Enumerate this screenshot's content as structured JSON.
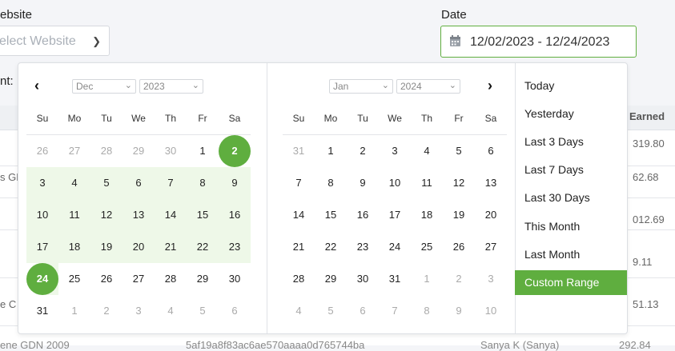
{
  "labels": {
    "website": "ebsite",
    "date": "Date",
    "count": "nt:"
  },
  "website_select": {
    "placeholder": "elect Website"
  },
  "date_input": {
    "value": "12/02/2023 - 12/24/2023"
  },
  "table": {
    "earned_header": "Earned",
    "values": [
      "319.80",
      "62.68",
      "012.69",
      "9.11",
      "51.13",
      "292.84"
    ],
    "left_fragments": [
      "s GD",
      "e C"
    ],
    "bottom_fragments": [
      "ene GDN 2009",
      "5af19a8f83ac6ae570aaaa0d765744ba",
      "Sanya K (Sanya)"
    ]
  },
  "left_calendar": {
    "month": "Dec",
    "year": "2023",
    "dow": [
      "Su",
      "Mo",
      "Tu",
      "We",
      "Th",
      "Fr",
      "Sa"
    ],
    "weeks": [
      [
        "26",
        "27",
        "28",
        "29",
        "30",
        "1",
        "2"
      ],
      [
        "3",
        "4",
        "5",
        "6",
        "7",
        "8",
        "9"
      ],
      [
        "10",
        "11",
        "12",
        "13",
        "14",
        "15",
        "16"
      ],
      [
        "17",
        "18",
        "19",
        "20",
        "21",
        "22",
        "23"
      ],
      [
        "24",
        "25",
        "26",
        "27",
        "28",
        "29",
        "30"
      ],
      [
        "31",
        "1",
        "2",
        "3",
        "4",
        "5",
        "6"
      ]
    ]
  },
  "right_calendar": {
    "month": "Jan",
    "year": "2024",
    "dow": [
      "Su",
      "Mo",
      "Tu",
      "We",
      "Th",
      "Fr",
      "Sa"
    ],
    "weeks": [
      [
        "31",
        "1",
        "2",
        "3",
        "4",
        "5",
        "6"
      ],
      [
        "7",
        "8",
        "9",
        "10",
        "11",
        "12",
        "13"
      ],
      [
        "14",
        "15",
        "16",
        "17",
        "18",
        "19",
        "20"
      ],
      [
        "21",
        "22",
        "23",
        "24",
        "25",
        "26",
        "27"
      ],
      [
        "28",
        "29",
        "30",
        "31",
        "1",
        "2",
        "3"
      ],
      [
        "4",
        "5",
        "6",
        "7",
        "8",
        "9",
        "10"
      ]
    ]
  },
  "ranges": [
    "Today",
    "Yesterday",
    "Last 3 Days",
    "Last 7 Days",
    "Last 30 Days",
    "This Month",
    "Last Month",
    "Custom Range"
  ],
  "active_range": "Custom Range",
  "colors": {
    "accent": "#5fae3f",
    "range_bg": "#eef8e8"
  }
}
